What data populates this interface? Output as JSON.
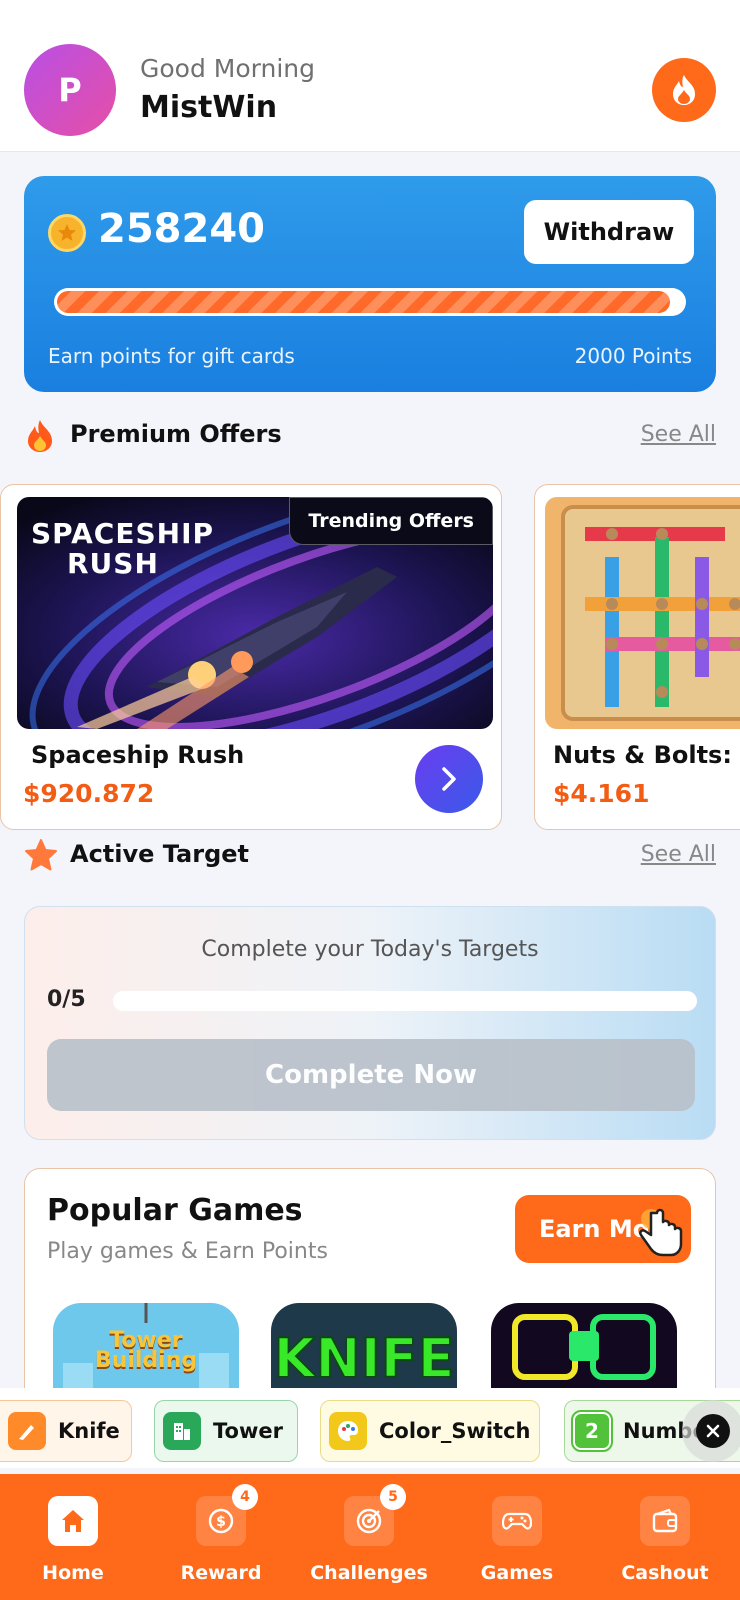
{
  "header": {
    "avatar_letter": "P",
    "greeting": "Good Morning",
    "username": "MistWin"
  },
  "points_card": {
    "points": "258240",
    "withdraw_label": "Withdraw",
    "progress_fraction": 0.98,
    "caption": "Earn points for gift cards",
    "target_points": "2000 Points"
  },
  "premium_offers": {
    "title": "Premium Offers",
    "see_all": "See All",
    "items": [
      {
        "image_title_line1": "SPACESHIP",
        "image_title_line2": "RUSH",
        "badge": "Trending Offers",
        "name": "Spaceship Rush",
        "price": "$920.872"
      },
      {
        "name": "Nuts & Bolts:",
        "price": "$4.161"
      }
    ]
  },
  "active_target": {
    "title": "Active Target",
    "see_all": "See All",
    "message": "Complete your Today's Targets",
    "count": "0/5",
    "progress_fraction": 0,
    "button_label": "Complete Now"
  },
  "popular_games": {
    "title": "Popular Games",
    "subtitle": "Play games & Earn Points",
    "earn_button": "Earn Mo",
    "thumbs": [
      {
        "text_line1": "Tower",
        "text_line2": "Building"
      },
      {
        "text": "KNIFE"
      },
      {
        "text": ""
      }
    ]
  },
  "chips": [
    {
      "label": "Knife",
      "icon": "knife-icon"
    },
    {
      "label": "Tower",
      "icon": "building-icon"
    },
    {
      "label": "Color_Switch",
      "icon": "palette-icon"
    },
    {
      "label": "Numbe",
      "icon_text": "2"
    }
  ],
  "bottom_nav": [
    {
      "label": "Home",
      "icon": "home-icon",
      "active": true
    },
    {
      "label": "Reward",
      "icon": "coin-icon",
      "badge": "4"
    },
    {
      "label": "Challenges",
      "icon": "target-icon",
      "badge": "5"
    },
    {
      "label": "Games",
      "icon": "gamepad-icon"
    },
    {
      "label": "Cashout",
      "icon": "wallet-icon"
    }
  ],
  "colors": {
    "accent": "#ff6a1a",
    "blue_card": "#1a7fe0",
    "price": "#f25c14"
  }
}
